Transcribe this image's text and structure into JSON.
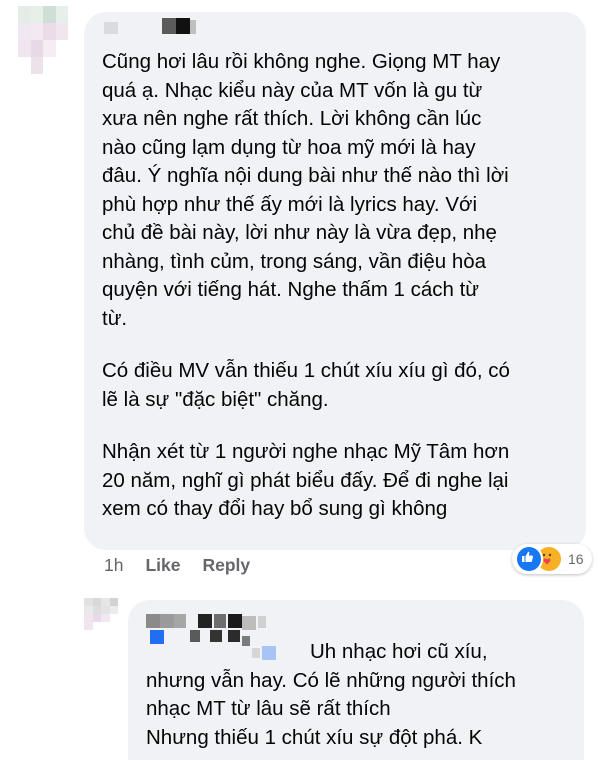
{
  "comment": {
    "paragraphs": [
      [
        "Cũng hơi lâu rồi không nghe. Giọng MT hay",
        "quá ạ. Nhạc kiểu này của MT vốn là gu từ",
        "xưa nên nghe rất thích. Lời không cần lúc",
        "nào cũng lạm dụng từ hoa mỹ mới là hay",
        "đâu. Ý nghĩa nội dung bài như thế nào thì lời",
        "phù hợp như thế ấy mới là lyrics hay. Với",
        "chủ đề bài này, lời như này là vừa đẹp, nhẹ",
        "nhàng, tình củm, trong sáng, vần điệu hòa",
        "quyện với tiếng hát. Nghe thấm 1 cách từ",
        "từ."
      ],
      [
        "Có điều MV vẫn thiếu 1 chút xíu xíu gì đó, có",
        "lẽ là sự \"đặc biệt\" chăng."
      ],
      [
        "Nhận xét từ 1 người nghe nhạc Mỹ Tâm hơn",
        "20 năm, nghĩ gì phát biểu đấy. Để đi nghe lại",
        "xem có thay đổi hay bổ sung gì không"
      ]
    ],
    "time": "1h",
    "like_label": "Like",
    "reply_label": "Reply",
    "reaction_count": "16",
    "reaction_icons": [
      "like-icon",
      "care-icon"
    ],
    "colors": {
      "bubble": "#f0f2f5",
      "meta": "#65676b",
      "like": "#1877f2"
    }
  },
  "reply": {
    "lines": [
      "Uh nhạc hơi cũ xíu,",
      "nhưng vẫn hay. Có lẽ những người thích",
      "nhạc MT từ lâu sẽ rất thích",
      "Nhưng thiếu 1 chút xíu sự đột phá. K"
    ]
  }
}
